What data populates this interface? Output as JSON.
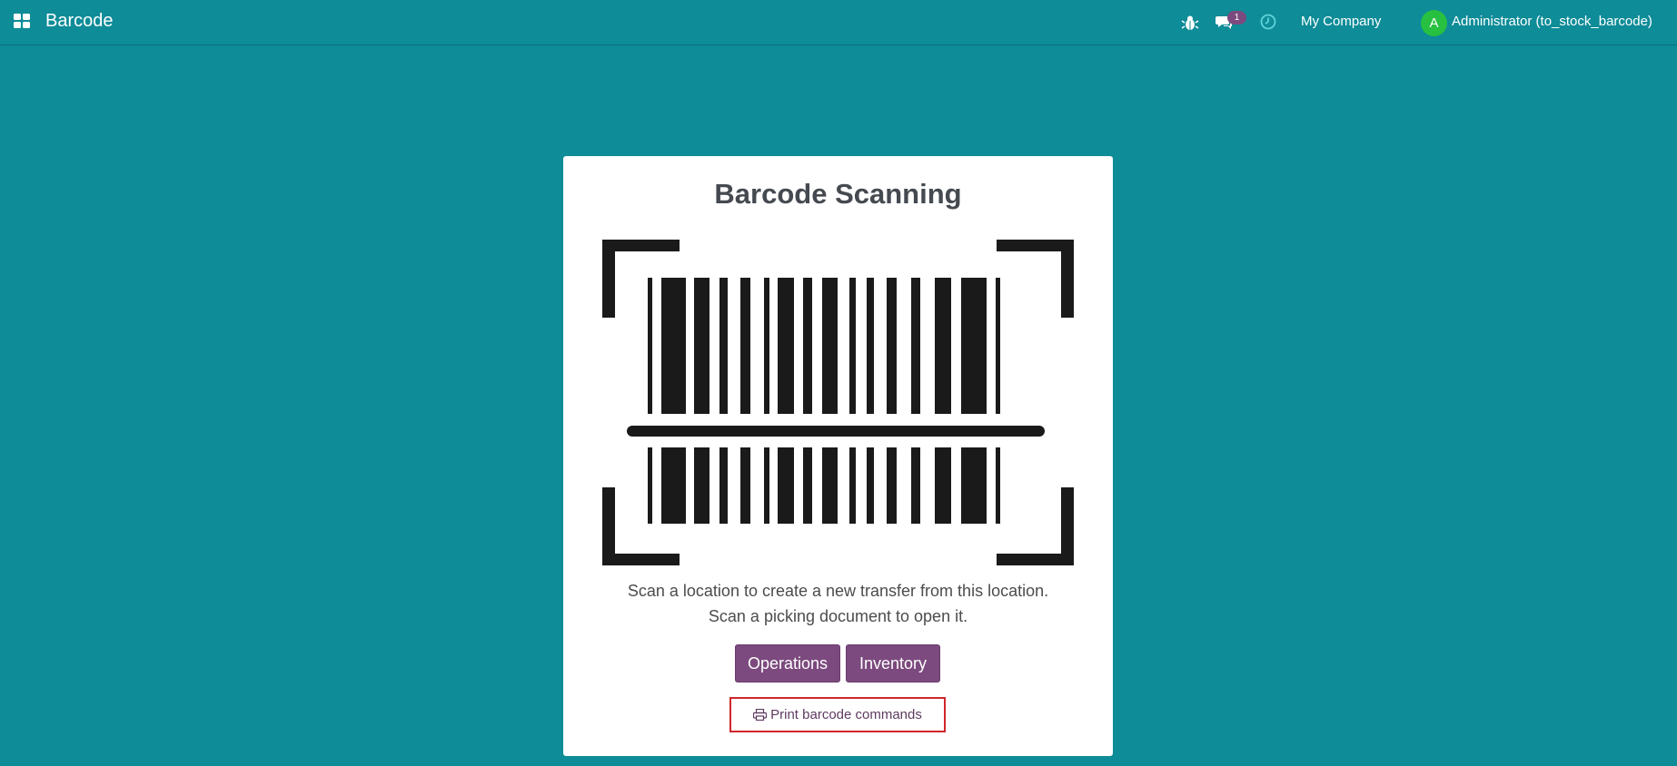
{
  "navbar": {
    "app_title": "Barcode",
    "messages_count": "1",
    "company": "My Company",
    "avatar_letter": "A",
    "user": "Administrator (to_stock_barcode)"
  },
  "card": {
    "title": "Barcode Scanning",
    "message_line1": "Scan a location to create a new transfer from this location.",
    "message_line2": "Scan a picking document to open it.",
    "buttons": {
      "operations": "Operations",
      "inventory": "Inventory"
    },
    "print_link": "Print barcode commands"
  },
  "colors": {
    "background": "#0e8c98",
    "primary": "#7c4a7e",
    "avatar": "#27c040",
    "highlight_border": "#d0262a"
  },
  "icons": [
    "apps-icon",
    "bug-icon",
    "chat-icon",
    "clock-icon",
    "printer-icon",
    "barcode-scan-illustration"
  ]
}
